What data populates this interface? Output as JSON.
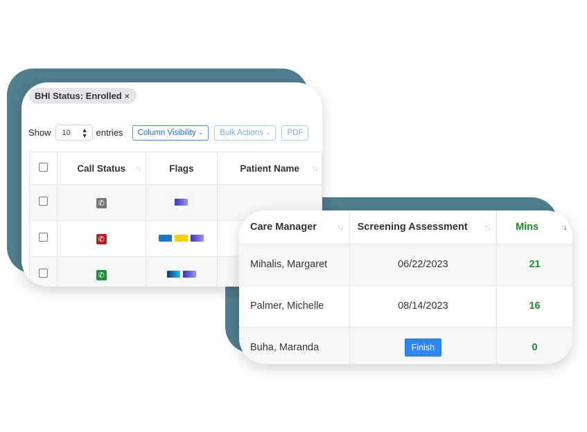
{
  "filter_chip": {
    "label": "BHI Status: Enrolled",
    "close": "×"
  },
  "controls": {
    "show_label": "Show",
    "entries_value": "10",
    "entries_label": "entries",
    "column_visibility": "Column Visibility",
    "bulk_actions": "Bulk Actions",
    "pdf": "PDF"
  },
  "table1": {
    "headers": {
      "call_status": "Call Status",
      "flags": "Flags",
      "patient_name": "Patient Name"
    },
    "rows": [
      {
        "call_color": "#777777",
        "flags": [
          "#6a5fd6"
        ]
      },
      {
        "call_color": "#b22222",
        "flags": [
          "#1b79c8",
          "#f5d000",
          "#6a5fd6"
        ]
      },
      {
        "call_color": "#1e8e3e",
        "flags": [
          "#0b4fb3",
          "#6a5fd6"
        ]
      }
    ]
  },
  "table2": {
    "headers": {
      "care_manager": "Care Manager",
      "screening": "Screening Assessment",
      "mins": "Mins"
    },
    "rows": [
      {
        "manager": "Mihalis, Margaret",
        "screening": "06/22/2023",
        "mins": "21"
      },
      {
        "manager": "Palmer, Michelle",
        "screening": "08/14/2023",
        "mins": "16"
      },
      {
        "manager": "Buha, Maranda",
        "screening_button": "Finish",
        "mins": "0"
      }
    ]
  }
}
